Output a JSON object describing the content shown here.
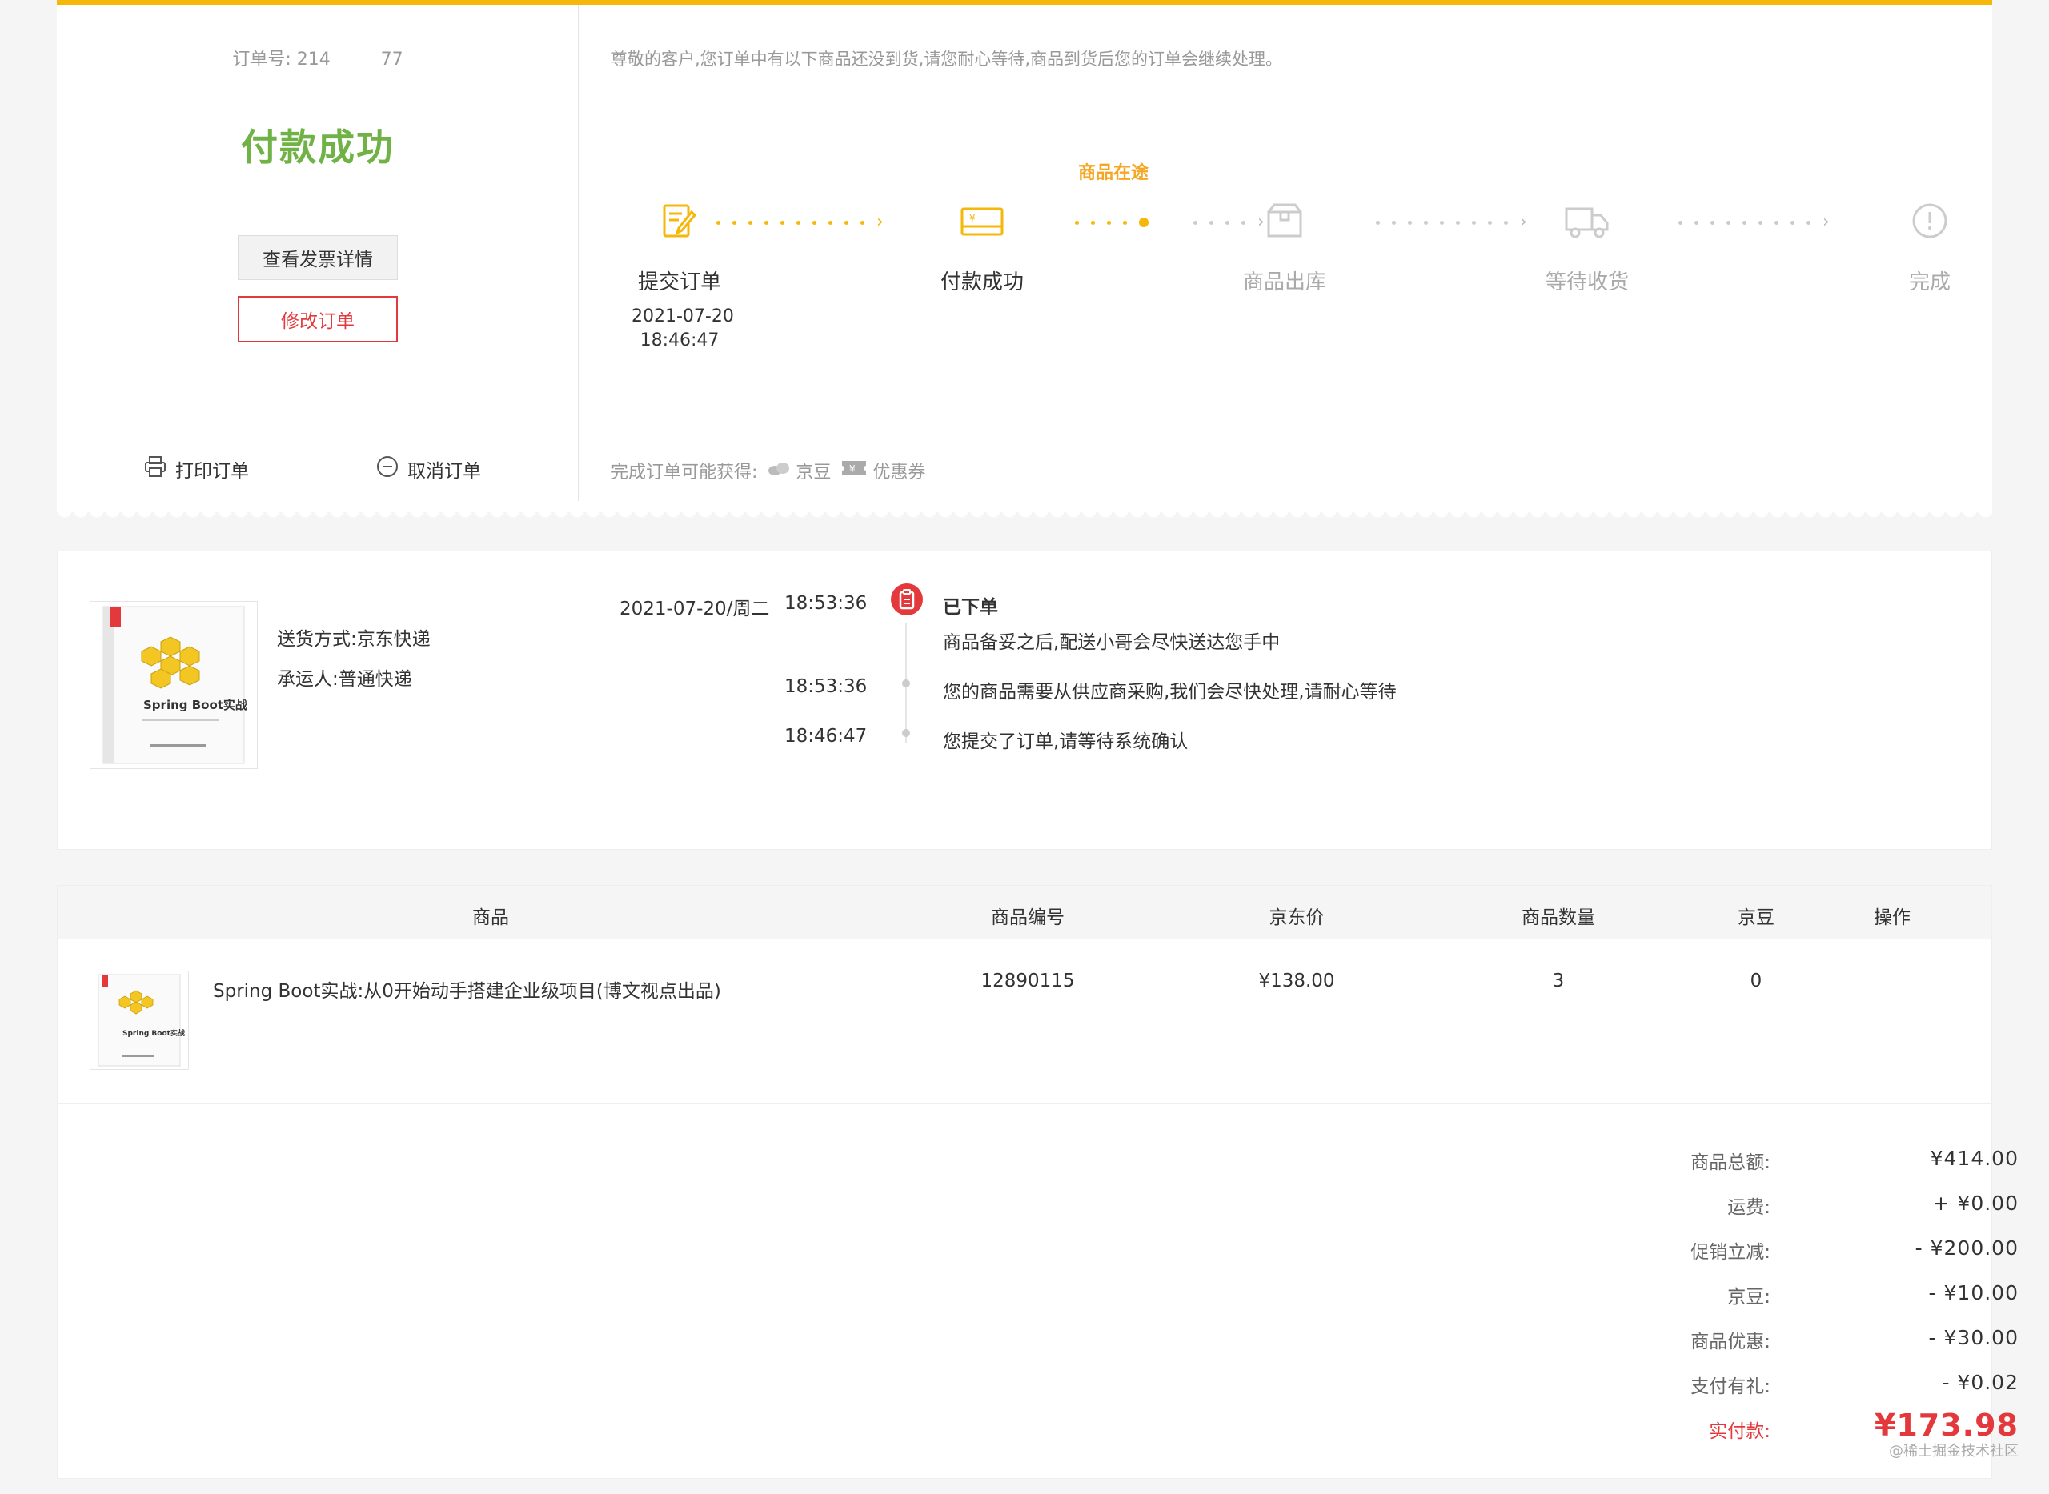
{
  "order": {
    "number_label": "订单号:",
    "number_value": "214         77",
    "pay_status": "付款成功",
    "invoice_button": "查看发票详情",
    "modify_button": "修改订单",
    "print_label": "打印订单",
    "cancel_label": "取消订单"
  },
  "progress": {
    "notice": "尊敬的客户,您订单中有以下商品还没到货,请您耐心等待,商品到货后您的订单会继续处理。",
    "transit_label": "商品在途",
    "steps": [
      {
        "label": "提交订单",
        "date": "2021-07-20",
        "time": "18:46:47",
        "icon": "edit-order-icon"
      },
      {
        "label": "付款成功",
        "icon": "payment-card-icon"
      },
      {
        "label": "商品出库",
        "icon": "package-icon"
      },
      {
        "label": "等待收货",
        "icon": "truck-icon"
      },
      {
        "label": "完成",
        "icon": "finish-icon"
      }
    ],
    "rewards_label": "完成订单可能获得:",
    "reward_beans": "京豆",
    "reward_coupon": "优惠券"
  },
  "shipping": {
    "method": "送货方式:京东快递",
    "carrier": "承运人:普通快递"
  },
  "tracking": {
    "date": "2021-07-20/周二",
    "status_title": "已下单",
    "entries": [
      {
        "time": "18:53:36",
        "text": "商品备妥之后,配送小哥会尽快送达您手中"
      },
      {
        "time": "18:53:36",
        "text": "您的商品需要从供应商采购,我们会尽快处理,请耐心等待"
      },
      {
        "time": "18:46:47",
        "text": "您提交了订单,请等待系统确认"
      }
    ]
  },
  "table": {
    "headers": {
      "product": "商品",
      "sku": "商品编号",
      "price": "京东价",
      "qty": "商品数量",
      "beans": "京豆",
      "action": "操作"
    },
    "rows": [
      {
        "name": "Spring Boot实战:从0开始动手搭建企业级项目(博文视点出品)",
        "sku": "12890115",
        "price": "¥138.00",
        "qty": "3",
        "beans": "0"
      }
    ]
  },
  "summary": [
    {
      "label": "商品总额:",
      "value": "¥414.00"
    },
    {
      "label": "运费:",
      "value": "+ ¥0.00"
    },
    {
      "label": "促销立减:",
      "value": "- ¥200.00"
    },
    {
      "label": "京豆:",
      "value": "- ¥10.00"
    },
    {
      "label": "商品优惠:",
      "value": "- ¥30.00"
    },
    {
      "label": "支付有礼:",
      "value": "- ¥0.02"
    },
    {
      "label": "实付款:",
      "value": "¥173.98"
    }
  ],
  "book_cover_text": "Spring Boot实战",
  "watermark": "@稀土掘金技术社区",
  "colors": {
    "accent": "#f5b70a",
    "success": "#71b247",
    "danger": "#e4393c",
    "muted": "#999999"
  }
}
